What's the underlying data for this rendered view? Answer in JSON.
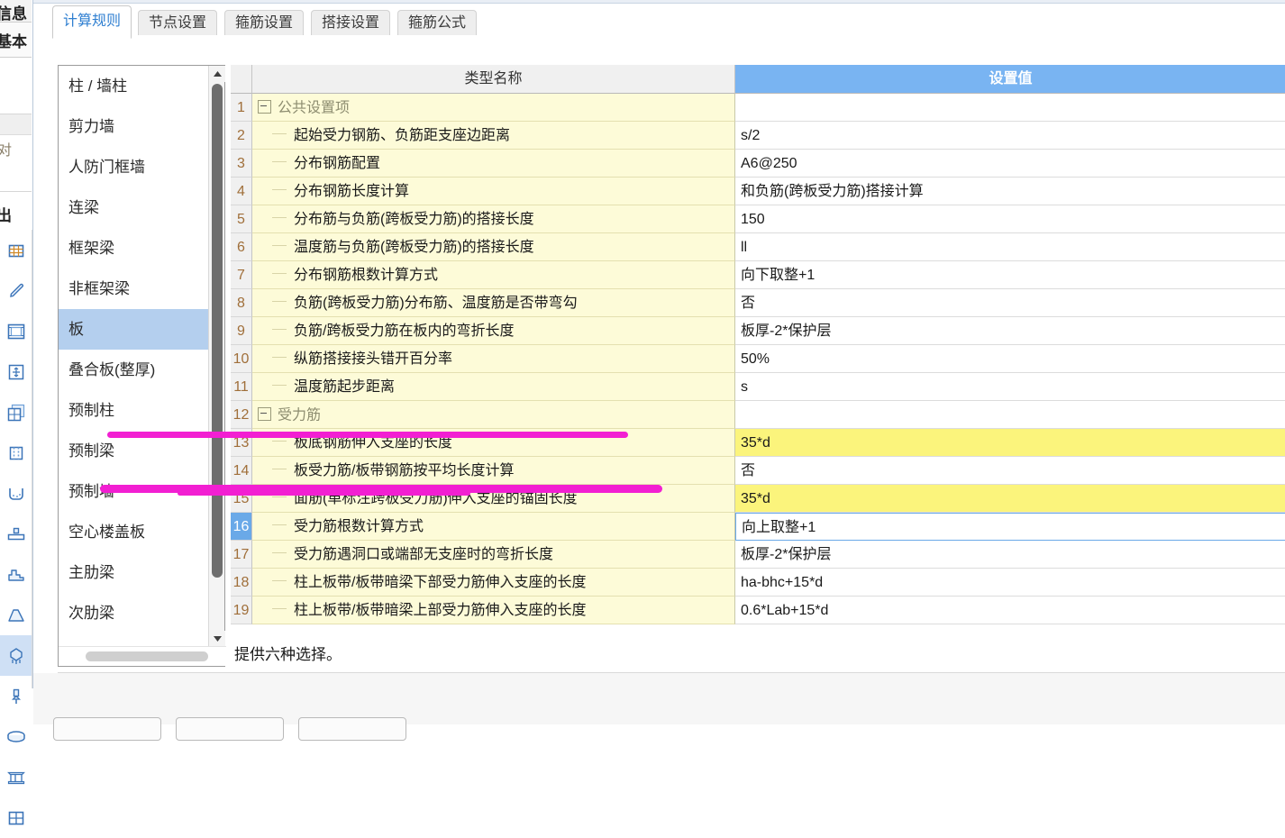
{
  "left_chrome": {
    "label_top": "信息",
    "label_second": "基本",
    "label_mid": "对",
    "label_out": "出",
    "tools": [
      {
        "name": "grid-layout-icon",
        "selected": false
      },
      {
        "name": "pencil-icon",
        "selected": false
      },
      {
        "name": "frame-grid-icon",
        "selected": false
      },
      {
        "name": "move-node-icon",
        "selected": false
      },
      {
        "name": "layered-grid-icon",
        "selected": false
      },
      {
        "name": "column-section-icon",
        "selected": false
      },
      {
        "name": "foundation-pit-icon",
        "selected": false
      },
      {
        "name": "pad-footing-icon",
        "selected": false
      },
      {
        "name": "stepped-footing-icon",
        "selected": false
      },
      {
        "name": "sloped-footing-icon",
        "selected": false
      },
      {
        "name": "pile-cap-icon",
        "selected": true
      },
      {
        "name": "pile-icon",
        "selected": false
      },
      {
        "name": "ellipse-slab-icon",
        "selected": false
      },
      {
        "name": "ribbed-foundation-icon",
        "selected": false
      },
      {
        "name": "window-grid-icon",
        "selected": false
      }
    ]
  },
  "tabs": [
    {
      "label": "计算规则",
      "active": true
    },
    {
      "label": "节点设置",
      "active": false
    },
    {
      "label": "箍筋设置",
      "active": false
    },
    {
      "label": "搭接设置",
      "active": false
    },
    {
      "label": "箍筋公式",
      "active": false
    }
  ],
  "categories": {
    "items": [
      {
        "label": "柱 / 墙柱",
        "selected": false
      },
      {
        "label": "剪力墙",
        "selected": false
      },
      {
        "label": "人防门框墙",
        "selected": false
      },
      {
        "label": "连梁",
        "selected": false
      },
      {
        "label": "框架梁",
        "selected": false
      },
      {
        "label": "非框架梁",
        "selected": false
      },
      {
        "label": "板",
        "selected": true
      },
      {
        "label": "叠合板(整厚)",
        "selected": false
      },
      {
        "label": "预制柱",
        "selected": false
      },
      {
        "label": "预制梁",
        "selected": false
      },
      {
        "label": "预制墙",
        "selected": false
      },
      {
        "label": "空心楼盖板",
        "selected": false
      },
      {
        "label": "主肋梁",
        "selected": false
      },
      {
        "label": "次肋梁",
        "selected": false
      }
    ]
  },
  "grid": {
    "headers": {
      "num": "",
      "name": "类型名称",
      "value": "设置值"
    },
    "rows": [
      {
        "num": "1",
        "name": "公共设置项",
        "value": "",
        "type": "group",
        "selected": false,
        "highlight": false,
        "editing": false
      },
      {
        "num": "2",
        "name": "起始受力钢筋、负筋距支座边距离",
        "value": "s/2",
        "type": "leaf",
        "selected": false,
        "highlight": false,
        "editing": false
      },
      {
        "num": "3",
        "name": "分布钢筋配置",
        "value": "A6@250",
        "type": "leaf",
        "selected": false,
        "highlight": false,
        "editing": false
      },
      {
        "num": "4",
        "name": "分布钢筋长度计算",
        "value": "和负筋(跨板受力筋)搭接计算",
        "type": "leaf",
        "selected": false,
        "highlight": false,
        "editing": false
      },
      {
        "num": "5",
        "name": "分布筋与负筋(跨板受力筋)的搭接长度",
        "value": "150",
        "type": "leaf",
        "selected": false,
        "highlight": false,
        "editing": false
      },
      {
        "num": "6",
        "name": "温度筋与负筋(跨板受力筋)的搭接长度",
        "value": "ll",
        "type": "leaf",
        "selected": false,
        "highlight": false,
        "editing": false
      },
      {
        "num": "7",
        "name": "分布钢筋根数计算方式",
        "value": "向下取整+1",
        "type": "leaf",
        "selected": false,
        "highlight": false,
        "editing": false
      },
      {
        "num": "8",
        "name": "负筋(跨板受力筋)分布筋、温度筋是否带弯勾",
        "value": "否",
        "type": "leaf",
        "selected": false,
        "highlight": false,
        "editing": false
      },
      {
        "num": "9",
        "name": "负筋/跨板受力筋在板内的弯折长度",
        "value": "板厚-2*保护层",
        "type": "leaf",
        "selected": false,
        "highlight": false,
        "editing": false
      },
      {
        "num": "10",
        "name": "纵筋搭接接头错开百分率",
        "value": "50%",
        "type": "leaf",
        "selected": false,
        "highlight": false,
        "editing": false
      },
      {
        "num": "11",
        "name": "温度筋起步距离",
        "value": "s",
        "type": "leaf",
        "selected": false,
        "highlight": false,
        "editing": false
      },
      {
        "num": "12",
        "name": "受力筋",
        "value": "",
        "type": "group",
        "selected": false,
        "highlight": false,
        "editing": false
      },
      {
        "num": "13",
        "name": "板底钢筋伸入支座的长度",
        "value": "35*d",
        "type": "leaf",
        "selected": false,
        "highlight": true,
        "editing": false
      },
      {
        "num": "14",
        "name": "板受力筋/板带钢筋按平均长度计算",
        "value": "否",
        "type": "leaf",
        "selected": false,
        "highlight": false,
        "editing": false
      },
      {
        "num": "15",
        "name": "面筋(单标注跨板受力筋)伸入支座的锚固长度",
        "value": "35*d",
        "type": "leaf",
        "selected": false,
        "highlight": true,
        "editing": false
      },
      {
        "num": "16",
        "name": "受力筋根数计算方式",
        "value": "向上取整+1",
        "type": "leaf",
        "selected": true,
        "highlight": false,
        "editing": true
      },
      {
        "num": "17",
        "name": "受力筋遇洞口或端部无支座时的弯折长度",
        "value": "板厚-2*保护层",
        "type": "leaf",
        "selected": false,
        "highlight": false,
        "editing": false
      },
      {
        "num": "18",
        "name": "柱上板带/板带暗梁下部受力筋伸入支座的长度",
        "value": "ha-bhc+15*d",
        "type": "leaf",
        "selected": false,
        "highlight": false,
        "editing": false
      },
      {
        "num": "19",
        "name": "柱上板带/板带暗梁上部受力筋伸入支座的长度",
        "value": "0.6*Lab+15*d",
        "type": "leaf",
        "selected": false,
        "highlight": false,
        "editing": false
      }
    ]
  },
  "hint": "提供六种选择。",
  "colors": {
    "header_accent": "#79b4f2",
    "row_name_bg": "#fdfbd8",
    "highlight_value_bg": "#fbf47c",
    "selection_bg": "#b4cfee",
    "annotation": "#f21fd2",
    "tab_active_text": "#2f7fd1"
  }
}
